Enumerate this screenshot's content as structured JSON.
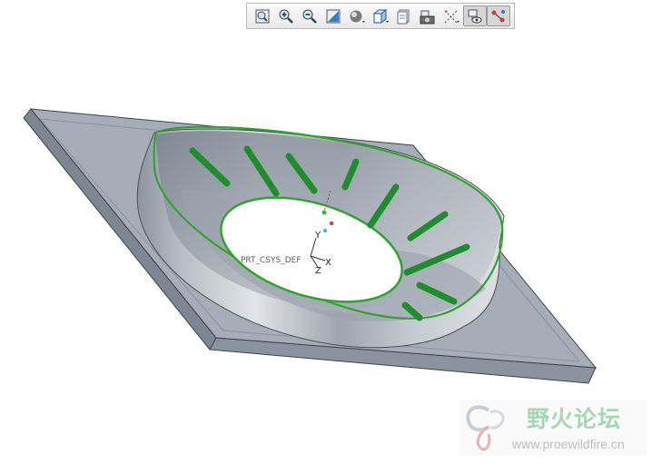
{
  "toolbar": {
    "buttons": [
      {
        "name": "refit-button",
        "icon": "refit-icon"
      },
      {
        "name": "zoom-in-button",
        "icon": "zoom-in-icon"
      },
      {
        "name": "zoom-out-button",
        "icon": "zoom-out-icon"
      },
      {
        "name": "repaint-button",
        "icon": "repaint-icon"
      },
      {
        "name": "display-style-button",
        "icon": "shaded-sphere-icon"
      },
      {
        "name": "saved-views-button",
        "icon": "cube-icon"
      },
      {
        "name": "view-manager-button",
        "icon": "view-manager-icon"
      },
      {
        "name": "perspective-button",
        "icon": "camera-icon"
      },
      {
        "name": "datum-display-button",
        "icon": "datum-axes-icon"
      },
      {
        "name": "annotation-display-button",
        "icon": "annotation-eye-icon",
        "active": true
      },
      {
        "name": "spin-center-button",
        "icon": "spin-center-icon",
        "active": true
      }
    ]
  },
  "model": {
    "csys_label": "PRT_CSYS_DEF",
    "axes": {
      "x": "X",
      "y": "Y",
      "z": "Z"
    },
    "colors": {
      "plate_top": "#a6acb6",
      "plate_side": "#7f8795",
      "wall_light": "#d9dce1",
      "wall_dark": "#8a919c",
      "highlight": "#2fa22f",
      "sketch_strokes": "#1d8a2a"
    }
  },
  "watermark": {
    "title": "野火论坛",
    "url": "www.proewildfire.cn"
  }
}
